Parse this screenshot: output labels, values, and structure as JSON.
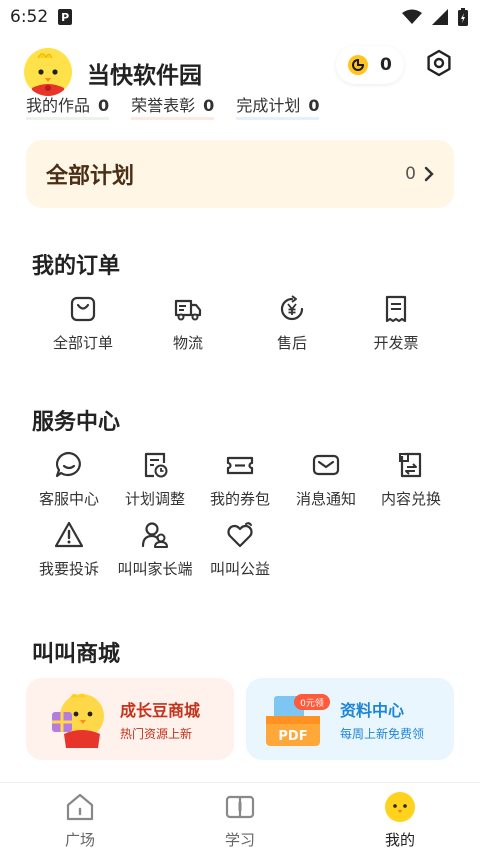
{
  "statusbar": {
    "time": "6:52",
    "app_badge": "P"
  },
  "profile": {
    "username": "当快软件园",
    "coins": "0"
  },
  "stats": [
    {
      "label": "我的作品",
      "value": "0"
    },
    {
      "label": "荣誉表彰",
      "value": "0"
    },
    {
      "label": "完成计划",
      "value": "0"
    }
  ],
  "plan": {
    "title": "全部计划",
    "count": "0"
  },
  "orders": {
    "title": "我的订单",
    "items": [
      {
        "label": "全部订单",
        "icon": "bag-icon"
      },
      {
        "label": "物流",
        "icon": "truck-icon"
      },
      {
        "label": "售后",
        "icon": "yen-return-icon"
      },
      {
        "label": "开发票",
        "icon": "invoice-icon"
      }
    ]
  },
  "services": {
    "title": "服务中心",
    "items": [
      {
        "label": "客服中心",
        "icon": "chat-icon"
      },
      {
        "label": "计划调整",
        "icon": "plan-clock-icon"
      },
      {
        "label": "我的券包",
        "icon": "coupon-icon"
      },
      {
        "label": "消息通知",
        "icon": "mail-icon"
      },
      {
        "label": "内容兑换",
        "icon": "exchange-icon"
      },
      {
        "label": "我要投诉",
        "icon": "warning-icon"
      },
      {
        "label": "叫叫家长端",
        "icon": "parent-icon"
      },
      {
        "label": "叫叫公益",
        "icon": "charity-icon"
      }
    ]
  },
  "mall": {
    "title": "叫叫商城",
    "cards": [
      {
        "title": "成长豆商城",
        "subtitle": "热门资源上新",
        "title_color": "#c2331c",
        "subtitle_color": "#c2331c",
        "bg": "#fff1ec"
      },
      {
        "title": "资料中心",
        "subtitle": "每周上新免费领",
        "badge": "0元领",
        "art_label": "PDF",
        "title_color": "#1f86d6",
        "subtitle_color": "#1f86d6",
        "bg": "#eaf6fd"
      }
    ]
  },
  "tabbar": {
    "tabs": [
      {
        "label": "广场",
        "icon": "home-icon"
      },
      {
        "label": "学习",
        "icon": "book-icon"
      },
      {
        "label": "我的",
        "icon": "chick-face-icon",
        "active": true
      }
    ]
  },
  "colors": {
    "accent_yellow": "#ffd21e",
    "plan_bg": "#fff6e6",
    "plan_text": "#4a2f16"
  }
}
